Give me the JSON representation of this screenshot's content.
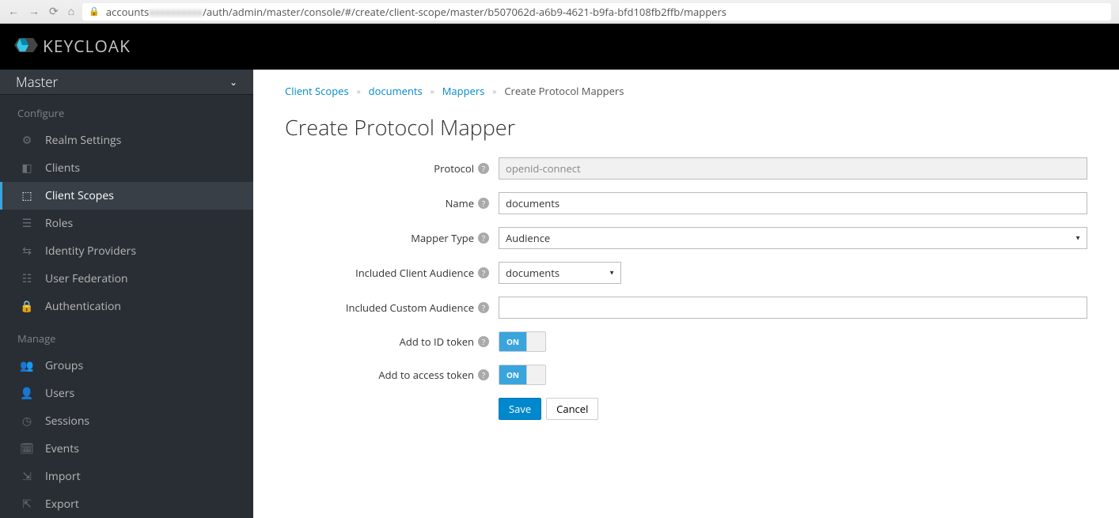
{
  "browser": {
    "url_visible_prefix": "accounts",
    "url_blurred": "xxxxxxxxxx",
    "url_visible_suffix": "/auth/admin/master/console/#/create/client-scope/master/b507062d-a6b9-4621-b9fa-bfd108fb2ffb/mappers"
  },
  "header": {
    "logo_text": "KEYCLOAK"
  },
  "sidebar": {
    "realm": "Master",
    "section_configure": "Configure",
    "section_manage": "Manage",
    "configure_items": [
      {
        "label": "Realm Settings",
        "icon": "sliders"
      },
      {
        "label": "Clients",
        "icon": "cube"
      },
      {
        "label": "Client Scopes",
        "icon": "cubes",
        "active": true
      },
      {
        "label": "Roles",
        "icon": "list"
      },
      {
        "label": "Identity Providers",
        "icon": "exchange"
      },
      {
        "label": "User Federation",
        "icon": "database"
      },
      {
        "label": "Authentication",
        "icon": "lock"
      }
    ],
    "manage_items": [
      {
        "label": "Groups",
        "icon": "group"
      },
      {
        "label": "Users",
        "icon": "user"
      },
      {
        "label": "Sessions",
        "icon": "clock"
      },
      {
        "label": "Events",
        "icon": "calendar"
      },
      {
        "label": "Import",
        "icon": "import"
      },
      {
        "label": "Export",
        "icon": "export"
      }
    ]
  },
  "breadcrumb": {
    "items": [
      "Client Scopes",
      "documents",
      "Mappers"
    ],
    "current": "Create Protocol Mappers"
  },
  "page": {
    "title": "Create Protocol Mapper"
  },
  "form": {
    "protocol_label": "Protocol",
    "protocol_value": "openid-connect",
    "name_label": "Name",
    "name_value": "documents",
    "mapper_type_label": "Mapper Type",
    "mapper_type_value": "Audience",
    "included_client_label": "Included Client Audience",
    "included_client_value": "documents",
    "included_custom_label": "Included Custom Audience",
    "included_custom_value": "",
    "add_id_token_label": "Add to ID token",
    "add_access_token_label": "Add to access token",
    "toggle_on": "ON",
    "save": "Save",
    "cancel": "Cancel"
  }
}
